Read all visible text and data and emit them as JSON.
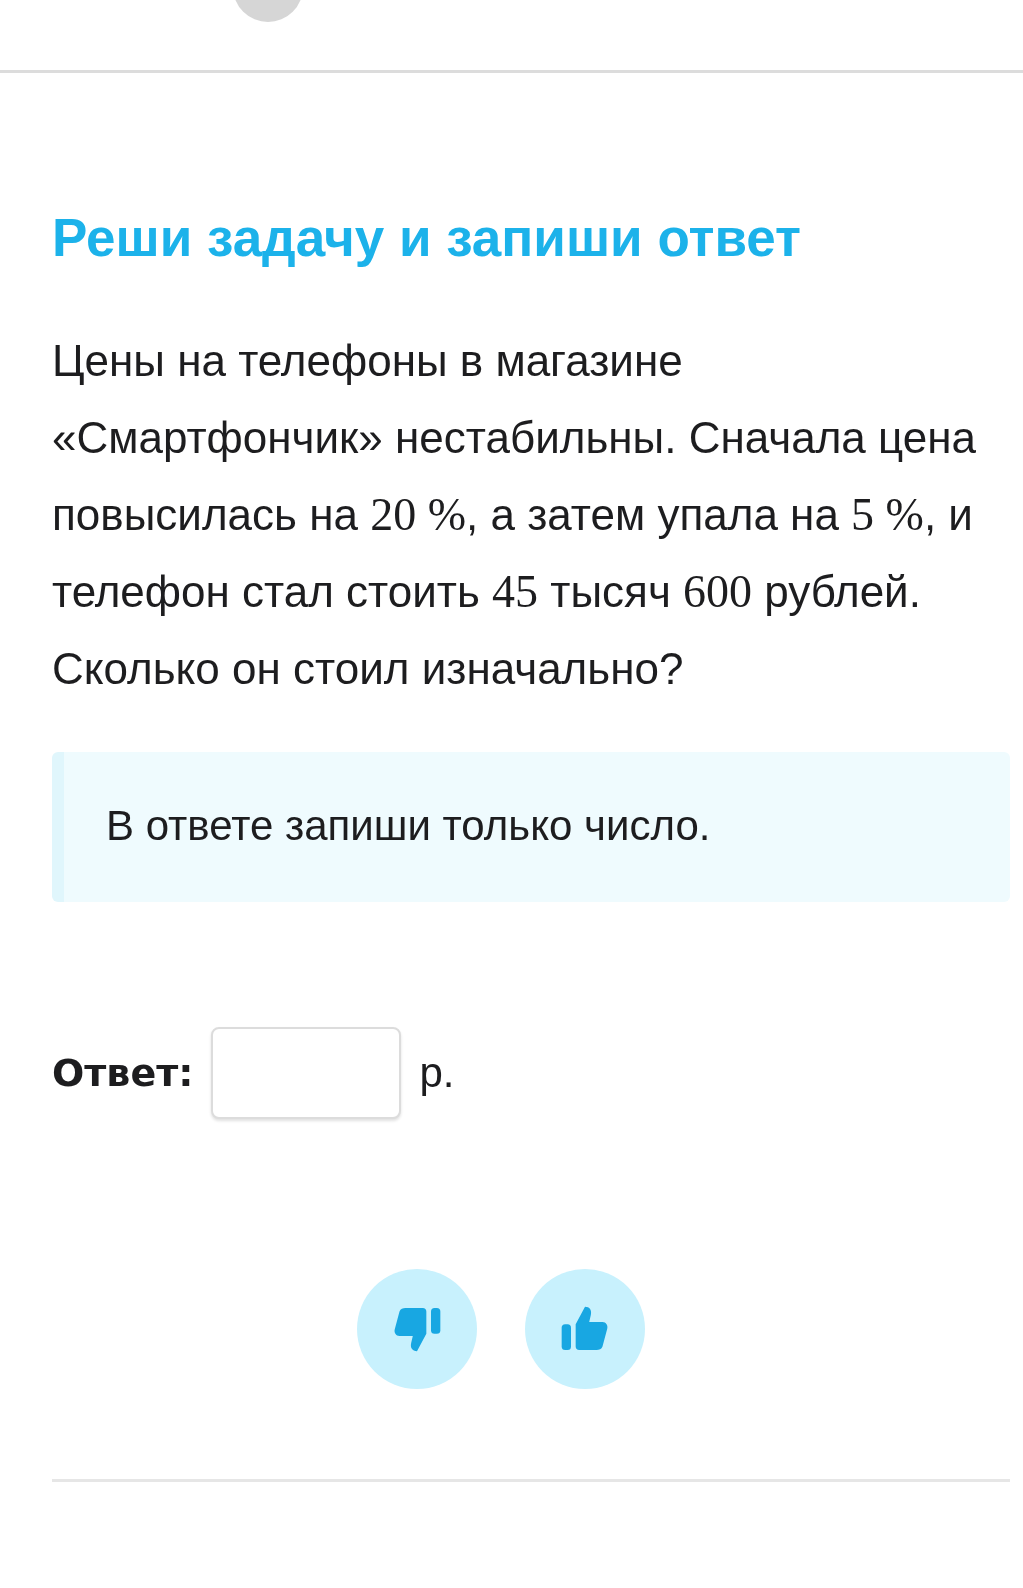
{
  "title": "Реши задачу и запиши ответ",
  "problem": [
    {
      "kind": "text",
      "s": "Цены на телефоны в магазине «Смартфончик» нестабильны. Сначала цена повысилась на "
    },
    {
      "kind": "math",
      "s": "20 %"
    },
    {
      "kind": "text",
      "s": ", а затем упала на "
    },
    {
      "kind": "math",
      "s": "5 %"
    },
    {
      "kind": "text",
      "s": ", и телефон стал стоить "
    },
    {
      "kind": "math",
      "s": "45"
    },
    {
      "kind": "text",
      "s": " тысяч "
    },
    {
      "kind": "math",
      "s": "600"
    },
    {
      "kind": "text",
      "s": " рублей. Сколько он стоил изначально?"
    }
  ],
  "hint": "В ответе запиши только число.",
  "answer": {
    "label": "Ответ:",
    "unit": "р."
  }
}
